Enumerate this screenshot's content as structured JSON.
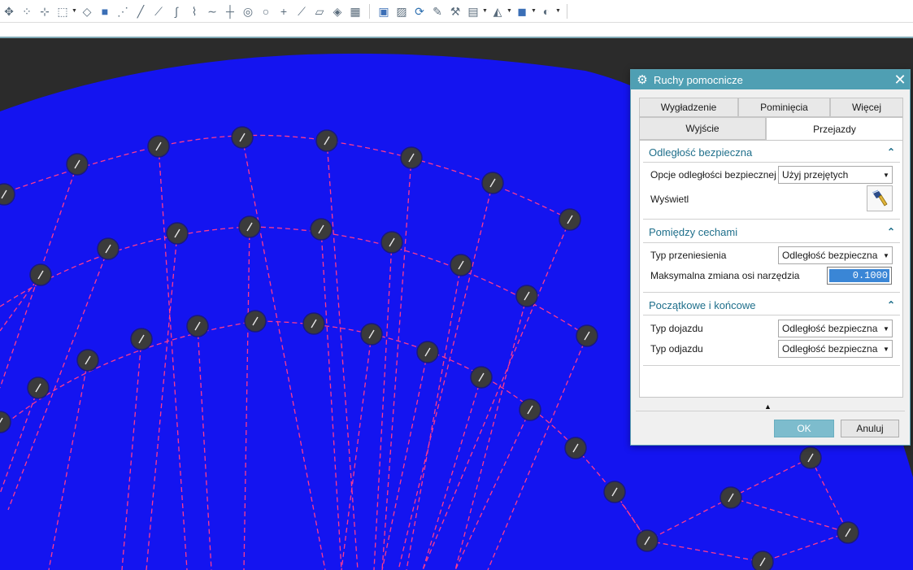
{
  "toolbar": {
    "group1": [
      "move-icon",
      "point-set-icon",
      "node-icon",
      "box-select-icon",
      "sketch-icon",
      "cube-icon",
      "mesh-icon",
      "line-icon",
      "line-segment-icon",
      "curve-icon",
      "polyline-icon",
      "spline-icon",
      "intersect-icon",
      "circle-icon",
      "target-icon",
      "plus-icon",
      "diagonal-icon",
      "sheet-icon",
      "layers-icon",
      "grid-icon"
    ],
    "group2": [
      "view-icon",
      "image-icon",
      "refresh-icon",
      "pen-icon",
      "tool-icon",
      "table-icon",
      "shade-icon",
      "solid-icon",
      "render-icon"
    ]
  },
  "dialog": {
    "title": "Ruchy pomocnicze",
    "tabs_row1": [
      "Wygładzenie",
      "Pominięcia",
      "Więcej"
    ],
    "tabs_row2": [
      "Wyjście",
      "Przejazdy"
    ],
    "active_tab": "Przejazdy",
    "sections": {
      "safe_distance": {
        "title": "Odległość bezpieczna",
        "options_label": "Opcje odległości bezpiecznej",
        "options_value": "Użyj przejętych",
        "display_label": "Wyświetl"
      },
      "between_features": {
        "title": "Pomiędzy cechami",
        "transfer_label": "Typ przeniesienia",
        "transfer_value": "Odległość bezpieczna",
        "max_change_label": "Maksymalna zmiana osi narzędzia",
        "max_change_value": "0.1000"
      },
      "start_end": {
        "title": "Początkowe i końcowe",
        "approach_label": "Typ dojazdu",
        "approach_value": "Odległość bezpieczna",
        "departure_label": "Typ odjazdu",
        "departure_value": "Odległość bezpieczna"
      }
    },
    "ok_label": "OK",
    "cancel_label": "Anuluj"
  },
  "colors": {
    "part_face": "#1414f0",
    "background": "#2b2b2b",
    "toolpath": "#ff3a8c",
    "holes": "#3b3b3b",
    "accent": "#4f9fb3"
  }
}
